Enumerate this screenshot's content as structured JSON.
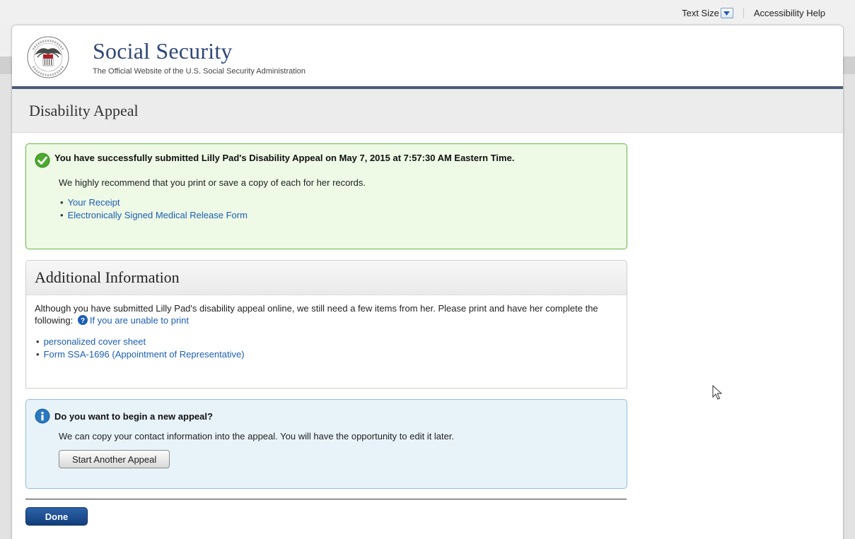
{
  "utility_bar": {
    "text_size_label": "Text Size",
    "accessibility_help_label": "Accessibility Help"
  },
  "header": {
    "title": "Social Security",
    "subtitle": "The Official Website of the U.S. Social Security Administration",
    "seal_text": "SOCIAL SECURITY ADMINISTRATION USA"
  },
  "page": {
    "title": "Disability Appeal"
  },
  "success_alert": {
    "icon": "check-circle-icon",
    "title": "You have successfully submitted Lilly Pad's Disability Appeal on May 7, 2015 at 7:57:30 AM Eastern Time.",
    "body": "We highly recommend that you print or save a copy of each for her records.",
    "links": [
      "Your Receipt",
      "Electronically Signed Medical Release Form"
    ]
  },
  "additional_info": {
    "title": "Additional Information",
    "body": "Although you have submitted Lilly Pad's disability appeal online, we still need a few items from her. Please print and have her complete the following:",
    "help_link": "If you are unable to print",
    "links": [
      "personalized cover sheet",
      "Form SSA-1696 (Appointment of Representative)"
    ]
  },
  "new_appeal": {
    "icon": "info-icon",
    "title": "Do you want to begin a new appeal?",
    "body": "We can copy your contact information into the appeal. You will have the opportunity to edit it later.",
    "button_label": "Start Another Appeal"
  },
  "footer": {
    "done_label": "Done"
  },
  "colors": {
    "brand_blue": "#2f4877",
    "link_blue": "#1c5fb3",
    "success_border": "#66b845",
    "success_bg": "#eef9e6",
    "info_border": "#8fc0da",
    "info_bg": "#e8f3f9",
    "primary_button": "#123f7c"
  }
}
